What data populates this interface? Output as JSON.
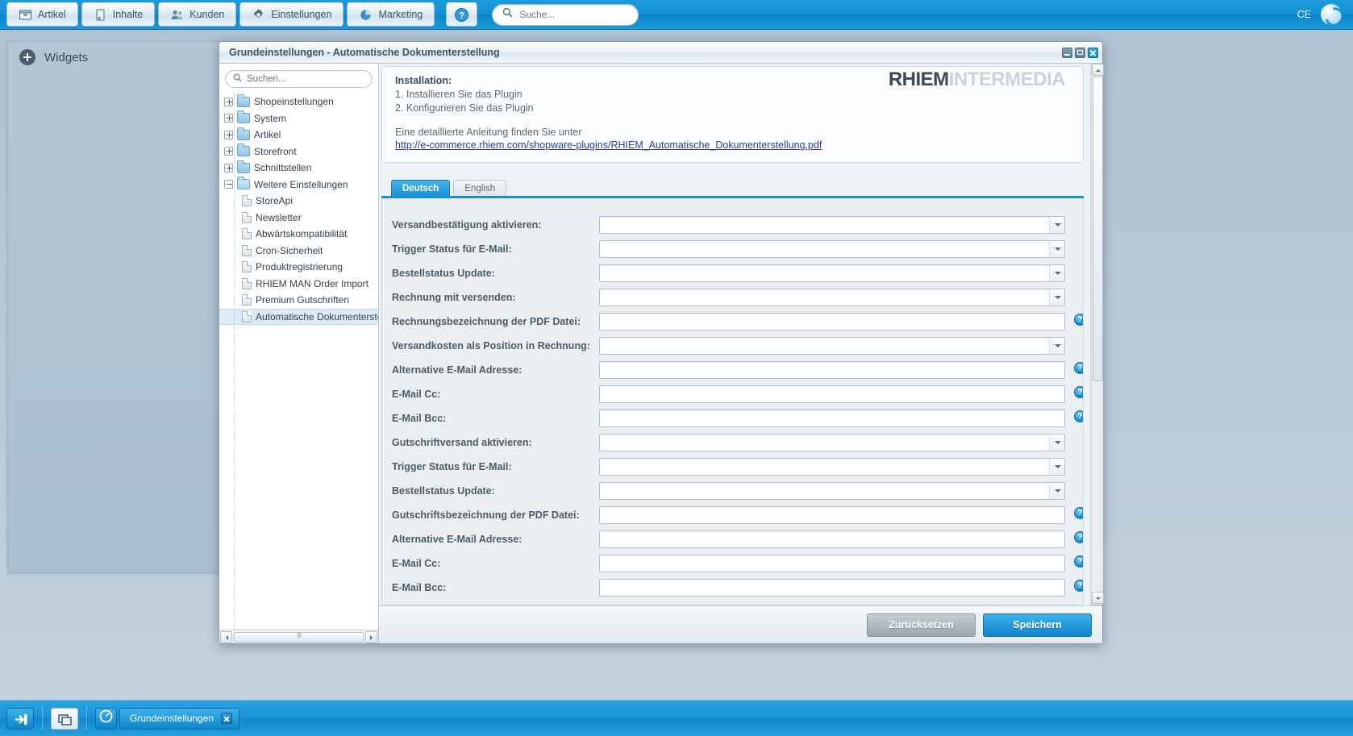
{
  "topbar": {
    "menu": [
      {
        "label": "Artikel",
        "icon": "box-icon"
      },
      {
        "label": "Inhalte",
        "icon": "page-icon"
      },
      {
        "label": "Kunden",
        "icon": "users-icon"
      },
      {
        "label": "Einstellungen",
        "icon": "gear-icon"
      },
      {
        "label": "Marketing",
        "icon": "piechart-icon"
      }
    ],
    "help_label": "?",
    "search_placeholder": "Suche...",
    "search_value": "",
    "user_initials": "CE",
    "logo": "shopware-logo-icon"
  },
  "widgets": {
    "title": "Widgets",
    "add_icon": "plus-circle-icon"
  },
  "window": {
    "title": "Grundeinstellungen - Automatische Dokumenterstellung",
    "controls": {
      "minimize": "minimize-icon",
      "maximize": "maximize-icon",
      "close": "close-icon"
    }
  },
  "tree": {
    "search_placeholder": "Suchen...",
    "search_value": "",
    "nodes": [
      {
        "label": "Shopeinstellungen",
        "type": "folder",
        "expanded": false,
        "selected": false
      },
      {
        "label": "System",
        "type": "folder",
        "expanded": false,
        "selected": false
      },
      {
        "label": "Artikel",
        "type": "folder",
        "expanded": false,
        "selected": false
      },
      {
        "label": "Storefront",
        "type": "folder",
        "expanded": false,
        "selected": false
      },
      {
        "label": "Schnittstellen",
        "type": "folder",
        "expanded": false,
        "selected": false
      },
      {
        "label": "Weitere Einstellungen",
        "type": "folder",
        "expanded": true,
        "selected": false
      }
    ],
    "children": [
      {
        "label": "StoreApi",
        "selected": false
      },
      {
        "label": "Newsletter",
        "selected": false
      },
      {
        "label": "Abwärtskompatibilität",
        "selected": false
      },
      {
        "label": "Cron-Sicherheit",
        "selected": false
      },
      {
        "label": "Produktregistrierung",
        "selected": false
      },
      {
        "label": "RHIEM MAN Order Import",
        "selected": false
      },
      {
        "label": "Premium Gutschriften",
        "selected": false
      },
      {
        "label": "Automatische Dokumenterstell",
        "selected": true
      }
    ]
  },
  "info": {
    "logo_primary": "RHIEM",
    "logo_secondary": "INTERMEDIA",
    "title": "Installation:",
    "step1": "1. Installieren Sie das Plugin",
    "step2": "2. Konfigurieren Sie das Plugin",
    "hint": "Eine detaillierte Anleitung finden Sie unter",
    "link": "http://e-commerce.rhiem.com/shopware-plugins/RHIEM_Automatische_Dokumenterstellung.pdf"
  },
  "tabs": [
    {
      "label": "Deutsch",
      "active": true
    },
    {
      "label": "English",
      "active": false
    }
  ],
  "form": {
    "fields": [
      {
        "label": "Versandbestätigung aktivieren:",
        "type": "select",
        "value": "",
        "help": false
      },
      {
        "label": "Trigger Status für E-Mail:",
        "type": "select",
        "value": "",
        "help": false
      },
      {
        "label": "Bestellstatus Update:",
        "type": "select",
        "value": "",
        "help": false
      },
      {
        "label": "Rechnung mit versenden:",
        "type": "select",
        "value": "",
        "help": false
      },
      {
        "label": "Rechnungsbezeichnung der PDF Datei:",
        "type": "text",
        "value": "",
        "help": true
      },
      {
        "label": "Versandkosten als Position in Rechnung:",
        "type": "select",
        "value": "",
        "help": false
      },
      {
        "label": "Alternative E-Mail Adresse:",
        "type": "text",
        "value": "",
        "help": true
      },
      {
        "label": "E-Mail Cc:",
        "type": "text",
        "value": "",
        "help": true
      },
      {
        "label": "E-Mail Bcc:",
        "type": "text",
        "value": "",
        "help": true
      },
      {
        "label": "Gutschriftversand aktivieren:",
        "type": "select",
        "value": "",
        "help": false
      },
      {
        "label": "Trigger Status für E-Mail:",
        "type": "select",
        "value": "",
        "help": false
      },
      {
        "label": "Bestellstatus Update:",
        "type": "select",
        "value": "",
        "help": false
      },
      {
        "label": "Gutschriftsbezeichnung der PDF Datei:",
        "type": "text",
        "value": "",
        "help": true
      },
      {
        "label": "Alternative E-Mail Adresse:",
        "type": "text",
        "value": "",
        "help": true
      },
      {
        "label": "E-Mail Cc:",
        "type": "text",
        "value": "",
        "help": true
      },
      {
        "label": "E-Mail Bcc:",
        "type": "text",
        "value": "",
        "help": true
      }
    ],
    "help_glyph": "?"
  },
  "footer": {
    "reset_label": "Zurücksetzen",
    "save_label": "Speichern"
  },
  "taskbar": {
    "logout_icon": "logout-icon",
    "windows_icon": "windows-stack-icon",
    "app_icon": "dashboard-icon",
    "task_label": "Grundeinstellungen",
    "task_close": "close-icon"
  },
  "colors": {
    "accent": "#1b93d8",
    "topbar": "#1390d6",
    "selection": "#dcecf7",
    "link": "#2b3ea8"
  }
}
